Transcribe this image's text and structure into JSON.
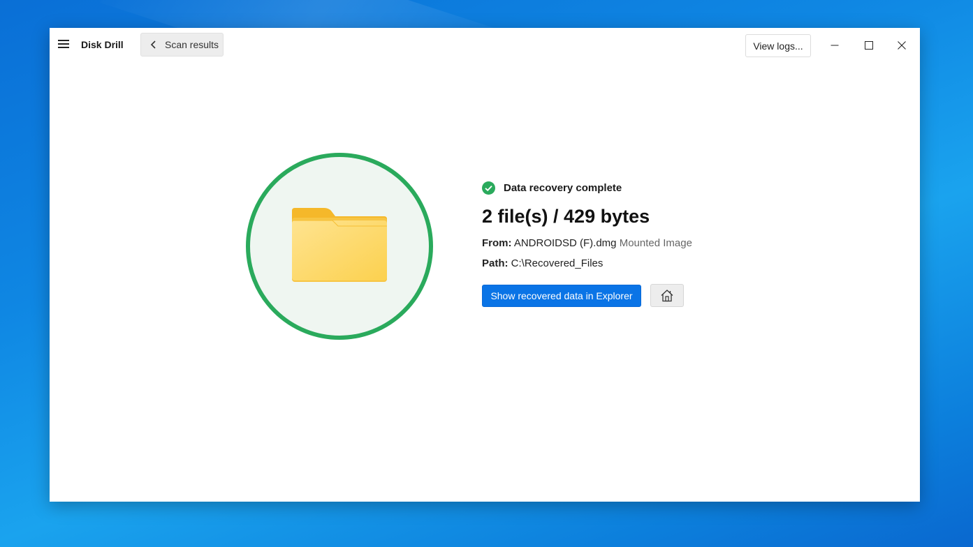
{
  "window": {
    "app_title": "Disk Drill",
    "back_button_label": "Scan results",
    "view_logs_label": "View logs..."
  },
  "result": {
    "status": "Data recovery complete",
    "summary": "2 file(s) / 429 bytes",
    "from_label": "From:",
    "from_value": "ANDROIDSD (F).dmg",
    "from_type": "Mounted Image",
    "path_label": "Path:",
    "path_value": "C:\\Recovered_Files",
    "show_button_label": "Show recovered data in Explorer"
  },
  "colors": {
    "accent": "#0a74e6",
    "success": "#2aaa5c",
    "folder": "#fcd35a"
  },
  "icons": [
    "hamburger-menu-icon",
    "chevron-left-icon",
    "minimize-icon",
    "maximize-icon",
    "close-icon",
    "folder-icon",
    "check-circle-icon",
    "home-icon"
  ]
}
